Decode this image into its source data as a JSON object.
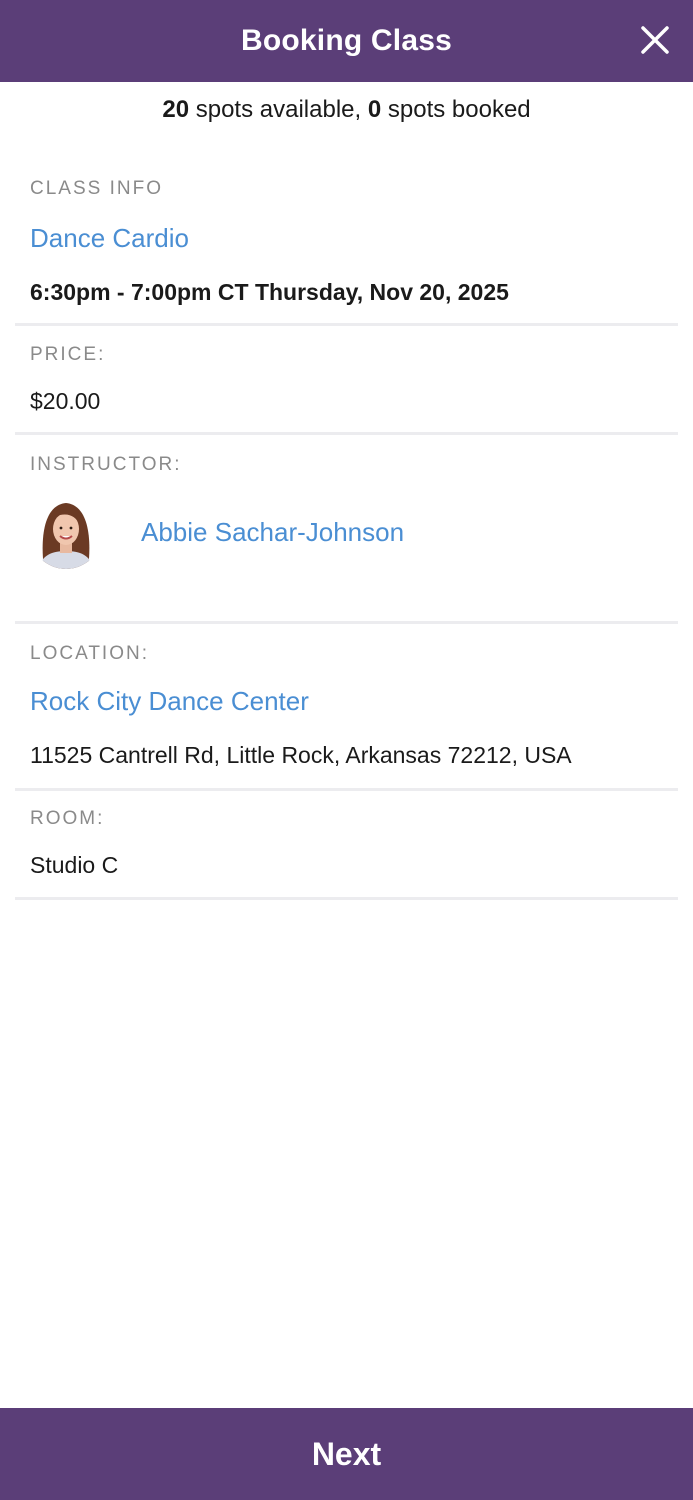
{
  "header": {
    "title": "Booking Class",
    "close_icon": "close-icon"
  },
  "spots": {
    "available_count": "20",
    "available_text": " spots available, ",
    "booked_count": "0",
    "booked_text": " spots booked"
  },
  "class_info": {
    "label": "CLASS INFO",
    "name": "Dance Cardio",
    "schedule": "6:30pm - 7:00pm CT Thursday, Nov 20, 2025"
  },
  "price": {
    "label": "PRICE:",
    "value": "$20.00"
  },
  "instructor": {
    "label": "INSTRUCTOR:",
    "name": "Abbie Sachar-Johnson",
    "avatar_icon": "instructor-avatar"
  },
  "location": {
    "label": "LOCATION:",
    "name": "Rock City Dance Center",
    "address": "11525 Cantrell Rd, Little Rock, Arkansas 72212, USA"
  },
  "room": {
    "label": "ROOM:",
    "value": "Studio C"
  },
  "footer": {
    "next_label": "Next"
  },
  "colors": {
    "brand_purple": "#5b3e78",
    "link_blue": "#4a8ed3",
    "label_gray": "#8a8a8a",
    "divider": "#ececef"
  }
}
